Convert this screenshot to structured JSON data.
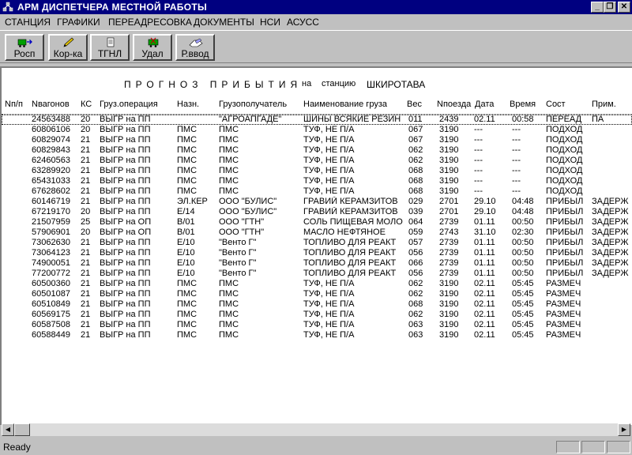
{
  "window": {
    "title": "АРМ ДИСПЕТЧЕРА МЕСТНОЙ РАБОТЫ"
  },
  "menu": [
    "СТАНЦИЯ",
    "ГРАФИКИ",
    "ПЕРЕАДРЕСОВКА",
    "ДОКУМЕНТЫ",
    "НСИ",
    "АСУСС"
  ],
  "toolbar": [
    {
      "label": "Росп",
      "icon": "wagon-arrow-icon"
    },
    {
      "label": "Кор-ка",
      "icon": "pencil-icon"
    },
    {
      "label": "ТГНЛ",
      "icon": "document-icon"
    },
    {
      "label": "Удал",
      "icon": "wagon-delete-icon"
    },
    {
      "label": "Р.ввод",
      "icon": "manual-input-icon"
    }
  ],
  "report": {
    "title": "ПРОГНОЗ ПРИБЫТИЯ",
    "na": "на",
    "station_label": "станцию",
    "station": "ШКИРОТАВА"
  },
  "columns": {
    "nn": "Nп/п",
    "vagon": "Nвагонов",
    "ks": "КС",
    "op": "Груз.операция",
    "nazn": "Назн.",
    "poluch": "Грузополучатель",
    "gruz": "Наименование груза",
    "ves": "Вес",
    "poezd": "Nпоезда",
    "data": "Дата",
    "vremya": "Время",
    "sost": "Сост",
    "prim": "Прим."
  },
  "rows": [
    {
      "nn": "",
      "vagon": "24563488",
      "ks": "20",
      "op": "ВЫГР на ПП",
      "nazn": "",
      "poluch": "\"АГРОАПГАДЕ\"",
      "gruz": "ШИНЫ ВСЯКИЕ РЕЗИН",
      "ves": "011",
      "poezd": "2439",
      "data": "02.11",
      "vremya": "00:58",
      "sost": "ПЕРЕАД",
      "prim": "ПА"
    },
    {
      "nn": "",
      "vagon": "60806106",
      "ks": "20",
      "op": "ВЫГР на ПП",
      "nazn": "ПМС",
      "poluch": "ПМС",
      "gruz": "ТУФ, НЕ П/А",
      "ves": "067",
      "poezd": "3190",
      "data": "---",
      "vremya": "---",
      "sost": "ПОДХОД",
      "prim": ""
    },
    {
      "nn": "",
      "vagon": "60829074",
      "ks": "21",
      "op": "ВЫГР на ПП",
      "nazn": "ПМС",
      "poluch": "ПМС",
      "gruz": "ТУФ, НЕ П/А",
      "ves": "067",
      "poezd": "3190",
      "data": "---",
      "vremya": "---",
      "sost": "ПОДХОД",
      "prim": ""
    },
    {
      "nn": "",
      "vagon": "60829843",
      "ks": "21",
      "op": "ВЫГР на ПП",
      "nazn": "ПМС",
      "poluch": "ПМС",
      "gruz": "ТУФ, НЕ П/А",
      "ves": "062",
      "poezd": "3190",
      "data": "---",
      "vremya": "---",
      "sost": "ПОДХОД",
      "prim": ""
    },
    {
      "nn": "",
      "vagon": "62460563",
      "ks": "21",
      "op": "ВЫГР на ПП",
      "nazn": "ПМС",
      "poluch": "ПМС",
      "gruz": "ТУФ, НЕ П/А",
      "ves": "062",
      "poezd": "3190",
      "data": "---",
      "vremya": "---",
      "sost": "ПОДХОД",
      "prim": ""
    },
    {
      "nn": "",
      "vagon": "63289920",
      "ks": "21",
      "op": "ВЫГР на ПП",
      "nazn": "ПМС",
      "poluch": "ПМС",
      "gruz": "ТУФ, НЕ П/А",
      "ves": "068",
      "poezd": "3190",
      "data": "---",
      "vremya": "---",
      "sost": "ПОДХОД",
      "prim": ""
    },
    {
      "nn": "",
      "vagon": "65431033",
      "ks": "21",
      "op": "ВЫГР на ПП",
      "nazn": "ПМС",
      "poluch": "ПМС",
      "gruz": "ТУФ, НЕ П/А",
      "ves": "068",
      "poezd": "3190",
      "data": "---",
      "vremya": "---",
      "sost": "ПОДХОД",
      "prim": ""
    },
    {
      "nn": "",
      "vagon": "67628602",
      "ks": "21",
      "op": "ВЫГР на ПП",
      "nazn": "ПМС",
      "poluch": "ПМС",
      "gruz": "ТУФ, НЕ П/А",
      "ves": "068",
      "poezd": "3190",
      "data": "---",
      "vremya": "---",
      "sost": "ПОДХОД",
      "prim": ""
    },
    {
      "nn": "",
      "vagon": "60146719",
      "ks": "21",
      "op": "ВЫГР на ПП",
      "nazn": "ЭЛ.КЕР",
      "poluch": "ООО \"БУЛИС\"",
      "gruz": "ГРАВИЙ КЕРАМЗИТОВ",
      "ves": "029",
      "poezd": "2701",
      "data": "29.10",
      "vremya": "04:48",
      "sost": "ПРИБЫЛ",
      "prim": "ЗАДЕРЖ"
    },
    {
      "nn": "",
      "vagon": "67219170",
      "ks": "20",
      "op": "ВЫГР на ПП",
      "nazn": "Е/14",
      "poluch": "ООО \"БУЛИС\"",
      "gruz": "ГРАВИЙ КЕРАМЗИТОВ",
      "ves": "039",
      "poezd": "2701",
      "data": "29.10",
      "vremya": "04:48",
      "sost": "ПРИБЫЛ",
      "prim": "ЗАДЕРЖ"
    },
    {
      "nn": "",
      "vagon": "21507959",
      "ks": "25",
      "op": "ВЫГР на ОП",
      "nazn": "В/01",
      "poluch": "ООО \"ГТН\"",
      "gruz": "СОЛЬ ПИЩЕВАЯ МОЛО",
      "ves": "064",
      "poezd": "2739",
      "data": "01.11",
      "vremya": "00:50",
      "sost": "ПРИБЫЛ",
      "prim": "ЗАДЕРЖ"
    },
    {
      "nn": "",
      "vagon": "57906901",
      "ks": "20",
      "op": "ВЫГР на ОП",
      "nazn": "В/01",
      "poluch": "ООО \"ГТН\"",
      "gruz": "МАСЛО НЕФТЯНОЕ",
      "ves": "059",
      "poezd": "2743",
      "data": "31.10",
      "vremya": "02:30",
      "sost": "ПРИБЫЛ",
      "prim": "ЗАДЕРЖ"
    },
    {
      "nn": "",
      "vagon": "73062630",
      "ks": "21",
      "op": "ВЫГР на ПП",
      "nazn": "Е/10",
      "poluch": "\"Венто Г\"",
      "gruz": "ТОПЛИВО ДЛЯ РЕАКТ",
      "ves": "057",
      "poezd": "2739",
      "data": "01.11",
      "vremya": "00:50",
      "sost": "ПРИБЫЛ",
      "prim": "ЗАДЕРЖ"
    },
    {
      "nn": "",
      "vagon": "73064123",
      "ks": "21",
      "op": "ВЫГР на ПП",
      "nazn": "Е/10",
      "poluch": "\"Венто Г\"",
      "gruz": "ТОПЛИВО ДЛЯ РЕАКТ",
      "ves": "056",
      "poezd": "2739",
      "data": "01.11",
      "vremya": "00:50",
      "sost": "ПРИБЫЛ",
      "prim": "ЗАДЕРЖ"
    },
    {
      "nn": "",
      "vagon": "74900051",
      "ks": "21",
      "op": "ВЫГР на ПП",
      "nazn": "Е/10",
      "poluch": "\"Венто Г\"",
      "gruz": "ТОПЛИВО ДЛЯ РЕАКТ",
      "ves": "066",
      "poezd": "2739",
      "data": "01.11",
      "vremya": "00:50",
      "sost": "ПРИБЫЛ",
      "prim": "ЗАДЕРЖ"
    },
    {
      "nn": "",
      "vagon": "77200772",
      "ks": "21",
      "op": "ВЫГР на ПП",
      "nazn": "Е/10",
      "poluch": "\"Венто Г\"",
      "gruz": "ТОПЛИВО ДЛЯ РЕАКТ",
      "ves": "056",
      "poezd": "2739",
      "data": "01.11",
      "vremya": "00:50",
      "sost": "ПРИБЫЛ",
      "prim": "ЗАДЕРЖ"
    },
    {
      "nn": "",
      "vagon": "60500360",
      "ks": "21",
      "op": "ВЫГР на ПП",
      "nazn": "ПМС",
      "poluch": "ПМС",
      "gruz": "ТУФ, НЕ П/А",
      "ves": "062",
      "poezd": "3190",
      "data": "02.11",
      "vremya": "05:45",
      "sost": "РАЗМЕЧ",
      "prim": ""
    },
    {
      "nn": "",
      "vagon": "60501087",
      "ks": "21",
      "op": "ВЫГР на ПП",
      "nazn": "ПМС",
      "poluch": "ПМС",
      "gruz": "ТУФ, НЕ П/А",
      "ves": "062",
      "poezd": "3190",
      "data": "02.11",
      "vremya": "05:45",
      "sost": "РАЗМЕЧ",
      "prim": ""
    },
    {
      "nn": "",
      "vagon": "60510849",
      "ks": "21",
      "op": "ВЫГР на ПП",
      "nazn": "ПМС",
      "poluch": "ПМС",
      "gruz": "ТУФ, НЕ П/А",
      "ves": "068",
      "poezd": "3190",
      "data": "02.11",
      "vremya": "05:45",
      "sost": "РАЗМЕЧ",
      "prim": ""
    },
    {
      "nn": "",
      "vagon": "60569175",
      "ks": "21",
      "op": "ВЫГР на ПП",
      "nazn": "ПМС",
      "poluch": "ПМС",
      "gruz": "ТУФ, НЕ П/А",
      "ves": "062",
      "poezd": "3190",
      "data": "02.11",
      "vremya": "05:45",
      "sost": "РАЗМЕЧ",
      "prim": ""
    },
    {
      "nn": "",
      "vagon": "60587508",
      "ks": "21",
      "op": "ВЫГР на ПП",
      "nazn": "ПМС",
      "poluch": "ПМС",
      "gruz": "ТУФ, НЕ П/А",
      "ves": "063",
      "poezd": "3190",
      "data": "02.11",
      "vremya": "05:45",
      "sost": "РАЗМЕЧ",
      "prim": ""
    },
    {
      "nn": "",
      "vagon": "60588449",
      "ks": "21",
      "op": "ВЫГР на ПП",
      "nazn": "ПМС",
      "poluch": "ПМС",
      "gruz": "ТУФ, НЕ П/А",
      "ves": "063",
      "poezd": "3190",
      "data": "02.11",
      "vremya": "05:45",
      "sost": "РАЗМЕЧ",
      "prim": ""
    }
  ],
  "status": {
    "text": "Ready"
  }
}
